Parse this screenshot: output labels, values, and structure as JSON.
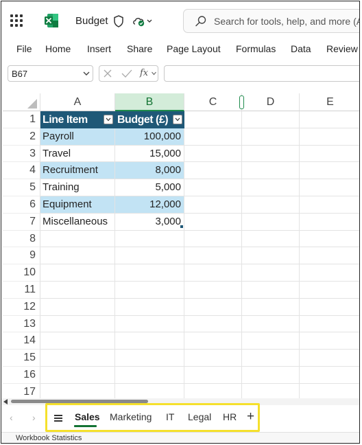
{
  "app": {
    "title": "Budget",
    "search_placeholder": "Search for tools, help, and more (A",
    "brand_color": "#107C41"
  },
  "menu": [
    "File",
    "Home",
    "Insert",
    "Share",
    "Page Layout",
    "Formulas",
    "Data",
    "Review"
  ],
  "formula_bar": {
    "name_box": "B67",
    "fx_label": "fx",
    "formula": ""
  },
  "sheet": {
    "column_headers": [
      "A",
      "B",
      "C",
      "D",
      "E"
    ],
    "selected_column": "B",
    "row_numbers": [
      "1",
      "2",
      "3",
      "4",
      "5",
      "6",
      "7",
      "8",
      "9",
      "10",
      "11",
      "12",
      "13",
      "14",
      "15",
      "16",
      "17"
    ],
    "table": {
      "header": [
        "Line Item",
        "Budget (£)"
      ],
      "rows": [
        [
          "Payroll",
          "100,000"
        ],
        [
          "Travel",
          "15,000"
        ],
        [
          "Recruitment",
          "8,000"
        ],
        [
          "Training",
          "5,000"
        ],
        [
          "Equipment",
          "12,000"
        ],
        [
          "Miscellaneous",
          "3,000"
        ]
      ],
      "header_color": "#1F5877",
      "band_color": "#C2E3F4"
    }
  },
  "tabs": {
    "items": [
      "Sales",
      "Marketing",
      "IT",
      "Legal",
      "HR"
    ],
    "active": "Sales",
    "highlight_color": "#F5E02C"
  },
  "status": {
    "text": "Workbook Statistics"
  }
}
